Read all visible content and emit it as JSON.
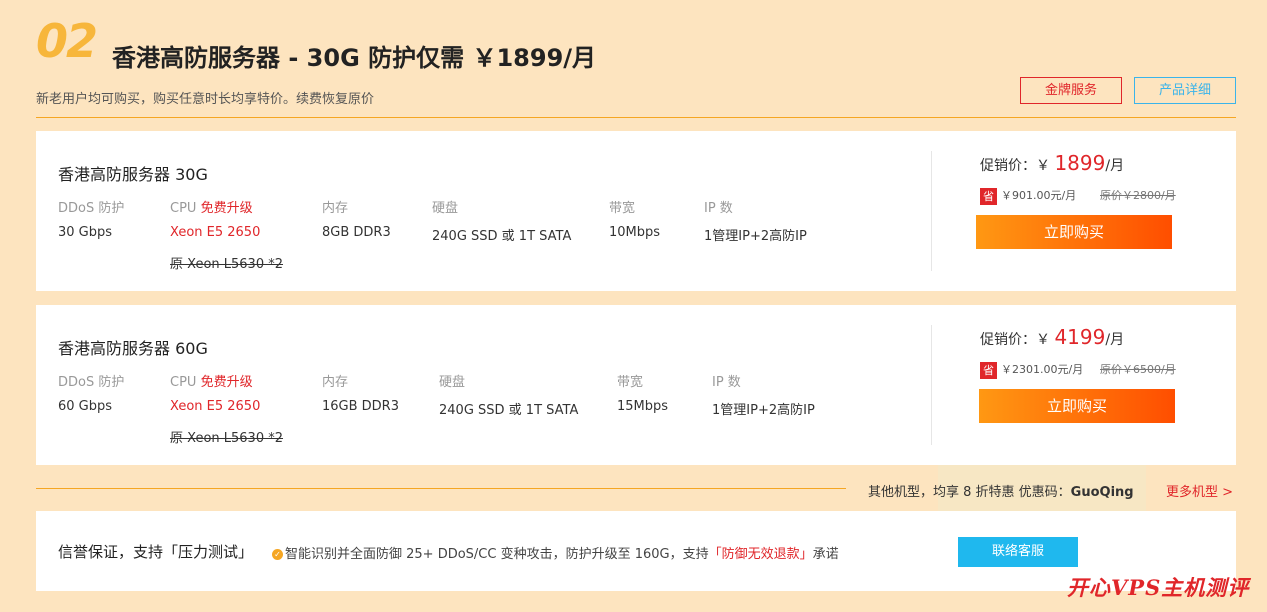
{
  "header": {
    "number": "02",
    "title": "香港高防服务器 - 30G 防护仅需 ￥1899/月",
    "subtitle": "新老用户均可购买，购买任意时长均享特价。续费恢复原价",
    "gold_service_label": "金牌服务",
    "product_detail_label": "产品详细"
  },
  "spec_labels": {
    "ddos": "DDoS 防护",
    "cpu": "CPU",
    "cpu_upgrade": "免费升级",
    "memory": "内存",
    "disk": "硬盘",
    "bandwidth": "带宽",
    "ip": "IP 数"
  },
  "products": [
    {
      "name": "香港高防服务器 30G",
      "ddos": "30 Gbps",
      "cpu": "Xeon E5 2650",
      "cpu_original": "原 Xeon L5630 *2",
      "memory": "8GB DDR3",
      "disk": "240G SSD 或 1T SATA",
      "bandwidth": "10Mbps",
      "ip": "1管理IP+2高防IP",
      "promo_label": "促销价：",
      "currency": "￥",
      "price": "1899",
      "per_month": "/月",
      "save_badge": "省",
      "save_amount": "￥901.00元/月",
      "original_price": "原价￥2800/月",
      "buy_label": "立即购买"
    },
    {
      "name": "香港高防服务器 60G",
      "ddos": "60 Gbps",
      "cpu": "Xeon E5 2650",
      "cpu_original": "原 Xeon L5630 *2",
      "memory": "16GB DDR3",
      "disk": "240G SSD 或 1T SATA",
      "bandwidth": "15Mbps",
      "ip": "1管理IP+2高防IP",
      "promo_label": "促销价：",
      "currency": "￥",
      "price": "4199",
      "per_month": "/月",
      "save_badge": "省",
      "save_amount": "￥2301.00元/月",
      "original_price": "原价￥6500/月",
      "buy_label": "立即购买"
    }
  ],
  "more_bar": {
    "text": "其他机型，均享 8 折特惠 优惠码：",
    "promo_code": "GuoQing",
    "more_link": "更多机型 >"
  },
  "guarantee": {
    "title": "信誉保证，支持「压力测试」",
    "desc_prefix": "智能识别并全面防御 25+ DDoS/CC 变种攻击，防护升级至 160G，支持",
    "desc_highlight": "「防御无效退款」",
    "desc_suffix": "承诺",
    "contact_label": "联络客服"
  },
  "watermark": "开心VPS主机测评",
  "colors": {
    "background": "#fde4bf",
    "accent_red": "#e0262a",
    "accent_blue": "#1fb8ee",
    "accent_orange": "#f5a623"
  }
}
